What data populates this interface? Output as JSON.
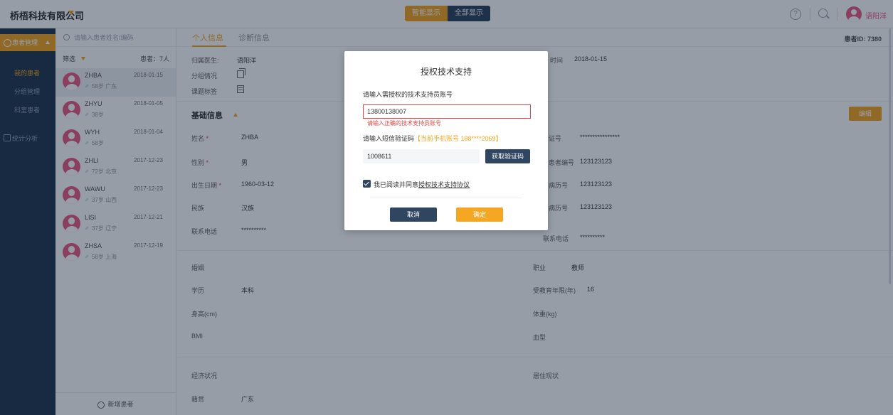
{
  "header": {
    "company": "桥梧科技有限公司",
    "toggle": [
      "智能显示",
      "全部显示"
    ],
    "user": "语阳洋"
  },
  "sidebar": {
    "main": "患者管理",
    "items": [
      "我的患者",
      "分组管理",
      "科室患者"
    ],
    "stats": "统计分析"
  },
  "patient_list": {
    "search_placeholder": "请输入患者姓名/编码",
    "filter": "筛选",
    "count": "患者：7人",
    "patients": [
      {
        "name": "ZHBA",
        "date": "2018-01-15",
        "gender": "♂",
        "info": "58岁 广东"
      },
      {
        "name": "ZHYU",
        "date": "2018-01-05",
        "gender": "♂",
        "info": "38岁"
      },
      {
        "name": "WYH",
        "date": "2018-01-04",
        "gender": "♂",
        "info": "58岁"
      },
      {
        "name": "ZHLI",
        "date": "2017-12-23",
        "gender": "♂",
        "info": "72岁 北京"
      },
      {
        "name": "WAWU",
        "date": "2017-12-23",
        "gender": "♂",
        "info": "37岁 山西"
      },
      {
        "name": "LISI",
        "date": "2017-12-21",
        "gender": "♂",
        "info": "37岁 辽宁"
      },
      {
        "name": "ZHSA",
        "date": "2017-12-19",
        "gender": "♂",
        "info": "58岁 上海"
      }
    ],
    "add_button": "新增患者"
  },
  "main": {
    "tabs": [
      "个人信息",
      "诊断信息"
    ],
    "patient_id": "患者ID: 7380",
    "top_fields": {
      "doctor_label": "归属医生:",
      "doctor_value": "语阳洋",
      "group_label": "分组情况",
      "tag_label": "课题标签",
      "time_label": "时间",
      "time_value": "2018-01-15"
    },
    "section_title": "基础信息",
    "edit_button": "编辑",
    "left_fields": [
      {
        "label": "姓名",
        "required": true,
        "value": "ZHBA"
      },
      {
        "label": "性别",
        "required": true,
        "value": "男"
      },
      {
        "label": "出生日期",
        "required": true,
        "value": "1960-03-12"
      },
      {
        "label": "民族",
        "required": false,
        "value": "汉族"
      },
      {
        "label": "联系电话",
        "required": false,
        "value": "**********"
      }
    ],
    "right_fields": [
      {
        "label": "证号",
        "value": "****************"
      },
      {
        "label": "患者编号",
        "value": "123123123"
      },
      {
        "label": "病历号",
        "value": "123123123"
      },
      {
        "label": "病历号",
        "value": "123123123"
      },
      {
        "label": "联系电话",
        "value": "**********"
      }
    ],
    "lower_left": [
      {
        "label": "婚姻",
        "value": ""
      },
      {
        "label": "学历",
        "value": "本科"
      },
      {
        "label": "身高(cm)",
        "value": ""
      },
      {
        "label": "BMI",
        "value": ""
      }
    ],
    "lower_right": [
      {
        "label": "职业",
        "value": "教师"
      },
      {
        "label": "受教育年限(年)",
        "value": "16"
      },
      {
        "label": "体重(kg)",
        "value": ""
      },
      {
        "label": "血型",
        "value": ""
      }
    ],
    "bottom_left": [
      {
        "label": "经济状况",
        "value": ""
      },
      {
        "label": "籍贯",
        "value": "广东"
      }
    ],
    "bottom_right": [
      {
        "label": "居住现状",
        "value": ""
      }
    ]
  },
  "modal": {
    "title": "授权技术支持",
    "account_label": "请输入需授权的技术支持员账号",
    "account_value": "13800138007",
    "account_error": "请输入正确的技术支持员账号",
    "code_label": "请输入短信验证码",
    "code_hint": "【当前手机账号 188****2069】",
    "code_value": "1008611",
    "get_code": "获取验证码",
    "agree_prefix": "我已阅读并同意",
    "agree_link": "授权技术支持协议",
    "cancel": "取消",
    "ok": "确定"
  },
  "colors": {
    "accent": "#f5a623",
    "navy": "#2f4560",
    "sidebar": "#253a52",
    "error": "#e94141",
    "avatar": "#e85c86"
  }
}
